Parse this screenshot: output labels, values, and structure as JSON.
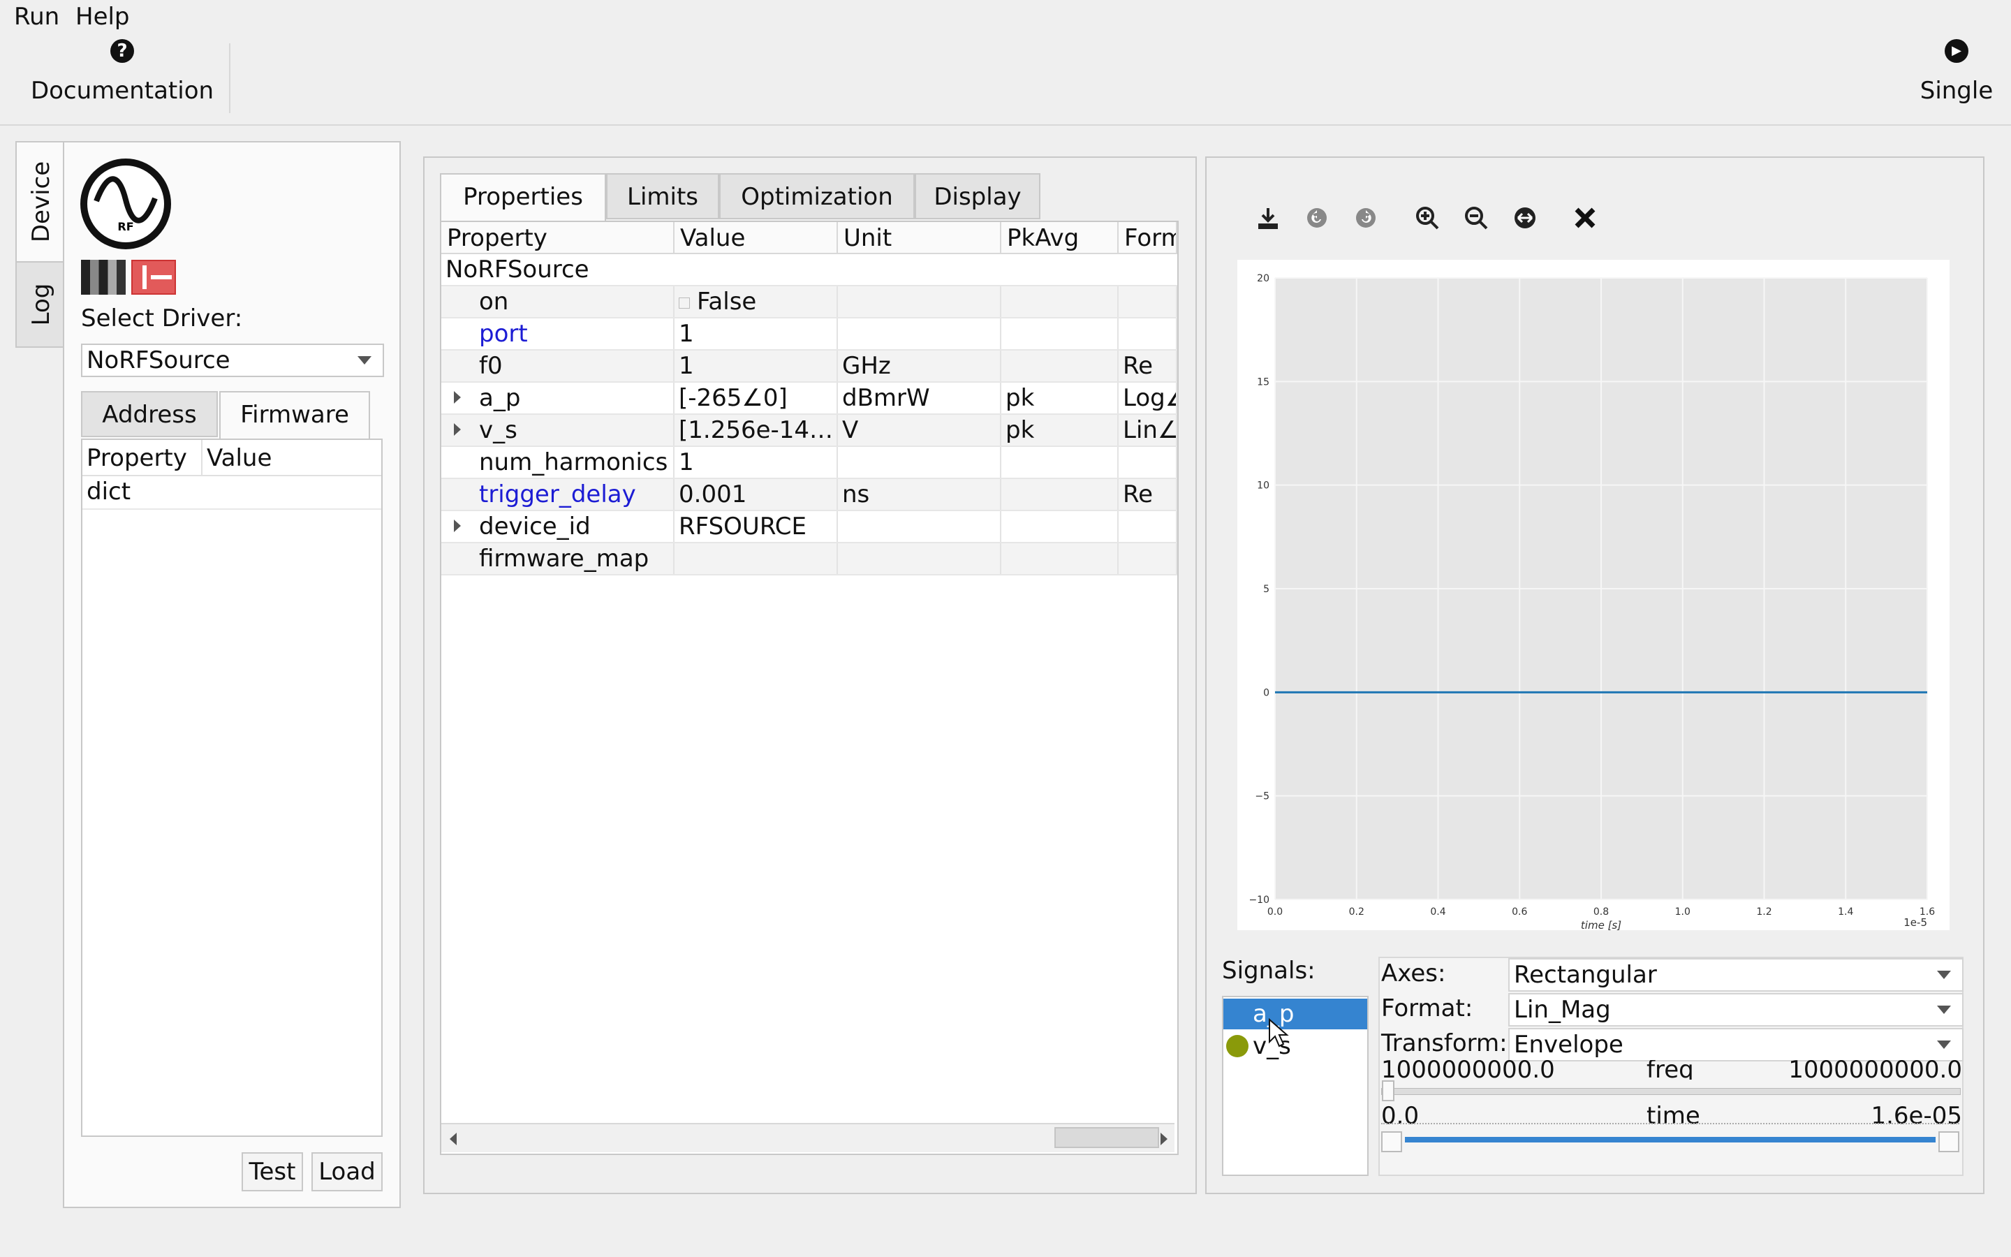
{
  "menu": {
    "items": [
      "Run",
      "Help"
    ]
  },
  "toolbar": {
    "documentation": {
      "icon": "help-circle-icon",
      "glyph": "?",
      "label": "Documentation"
    },
    "single": {
      "icon": "play-circle-icon",
      "glyph": "▶",
      "label": "Single"
    }
  },
  "sidebar_tabs": {
    "device": "Device",
    "log": "Log"
  },
  "device": {
    "logo_text": "RF",
    "select_driver_label": "Select Driver:",
    "driver_value": "NoRFSource",
    "tabs": {
      "address": "Address",
      "firmware": "Firmware"
    },
    "firmware_table": {
      "headers": [
        "Property",
        "Value"
      ],
      "rows": [
        "dict"
      ]
    },
    "buttons": {
      "test": "Test",
      "load": "Load"
    }
  },
  "properties_panel": {
    "tabs": [
      "Properties",
      "Limits",
      "Optimization",
      "Display"
    ],
    "headers": [
      "Property",
      "Value",
      "Unit",
      "PkAvg",
      "Form"
    ],
    "group": "NoRFSource",
    "rows": [
      {
        "property": "on",
        "value": "False",
        "unit": "",
        "pkavg": "",
        "format": "",
        "checkbox": true
      },
      {
        "property": "port",
        "value": "1",
        "unit": "",
        "pkavg": "",
        "format": "",
        "link": true
      },
      {
        "property": "f0",
        "value": "1",
        "unit": "GHz",
        "pkavg": "",
        "format": "Re"
      },
      {
        "property": "a_p",
        "value": "[-265∠0]",
        "unit": "dBmrW",
        "pkavg": "pk",
        "format": "Log∠",
        "expandable": true
      },
      {
        "property": "v_s",
        "value": "[1.256e-14…",
        "unit": "V",
        "pkavg": "pk",
        "format": "Lin∠",
        "expandable": true
      },
      {
        "property": "num_harmonics",
        "value": "1",
        "unit": "",
        "pkavg": "",
        "format": ""
      },
      {
        "property": "trigger_delay",
        "value": "0.001",
        "unit": "ns",
        "pkavg": "",
        "format": "Re",
        "link": true
      },
      {
        "property": "device_id",
        "value": "RFSOURCE",
        "unit": "",
        "pkavg": "",
        "format": "",
        "expandable": true
      },
      {
        "property": "firmware_map",
        "value": "",
        "unit": "",
        "pkavg": "",
        "format": ""
      }
    ]
  },
  "plot_toolbar": [
    "save-icon",
    "undo-icon",
    "redo-icon",
    "zoom-in-icon",
    "zoom-out-icon",
    "pan-icon",
    "close-icon"
  ],
  "chart_data": {
    "type": "line",
    "xlabel": "time [s]",
    "x_offset_label": "1e-5",
    "xlim": [
      0.0,
      1.6
    ],
    "ylim": [
      -10,
      20
    ],
    "x_ticks": [
      "0.0",
      "0.2",
      "0.4",
      "0.6",
      "0.8",
      "1.0",
      "1.2",
      "1.4",
      "1.6"
    ],
    "y_ticks": [
      "20",
      "15",
      "10",
      "5",
      "0",
      "−5",
      "−10"
    ],
    "grid": true,
    "series": [
      {
        "x": [
          0.0,
          1.6
        ],
        "y": [
          0,
          0
        ],
        "color": "#1f77b4"
      }
    ]
  },
  "signals": {
    "label": "Signals:",
    "items": [
      {
        "name": "a_p",
        "selected": true
      },
      {
        "name": "v_s",
        "marker_color": "#8a9a0a"
      }
    ]
  },
  "plot_settings": {
    "axes_label": "Axes:",
    "axes_value": "Rectangular",
    "format_label": "Format:",
    "format_value": "Lin_Mag",
    "transform_label": "Transform:",
    "transform_value": "Envelope",
    "freq": {
      "min": "1000000000.0",
      "label": "freq",
      "max": "1000000000.0"
    },
    "time": {
      "min": "0.0",
      "label": "time",
      "max": "1.6e-05"
    }
  },
  "colors": {
    "accent": "#3584d0",
    "link": "#1c1cd4",
    "plot_bg": "#e6e6e6",
    "line": "#1f77b4"
  }
}
